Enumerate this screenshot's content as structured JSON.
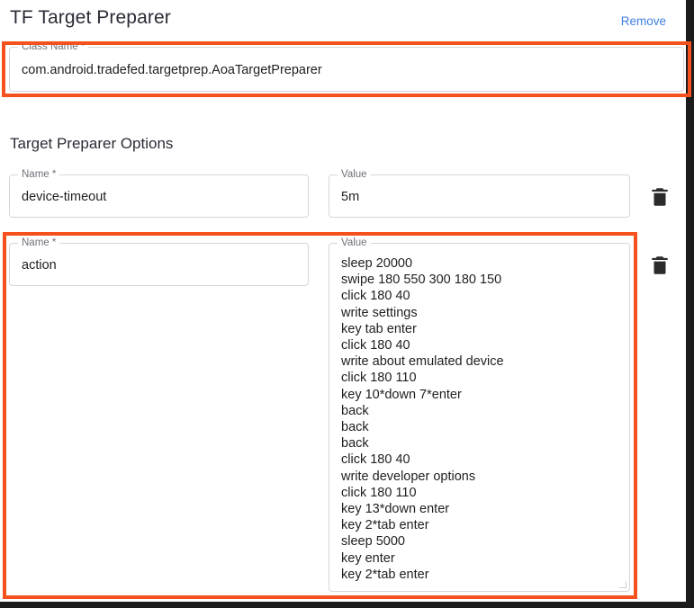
{
  "header": {
    "title": "TF Target Preparer",
    "remove_label": "Remove",
    "link_color": "#3f7fe0"
  },
  "highlight": {
    "color": "#f4511e"
  },
  "class_name_field": {
    "label": "Class Name *",
    "value": "com.android.tradefed.targetprep.AoaTargetPreparer"
  },
  "options_section": {
    "heading": "Target Preparer Options",
    "rows": [
      {
        "name_label": "Name *",
        "name_value": "device-timeout",
        "value_label": "Value",
        "value_value": "5m",
        "delete_icon": "trash-icon"
      },
      {
        "name_label": "Name *",
        "name_value": "action",
        "value_label": "Value",
        "value_value": "sleep 20000\nswipe 180 550 300 180 150\nclick 180 40\nwrite settings\nkey tab enter\nclick 180 40\nwrite about emulated device\nclick 180 110\nkey 10*down 7*enter\nback\nback\nback\nclick 180 40\nwrite developer options\nclick 180 110\nkey 13*down enter\nkey 2*tab enter\nsleep 5000\nkey enter\nkey 2*tab enter",
        "delete_icon": "trash-icon"
      }
    ]
  }
}
